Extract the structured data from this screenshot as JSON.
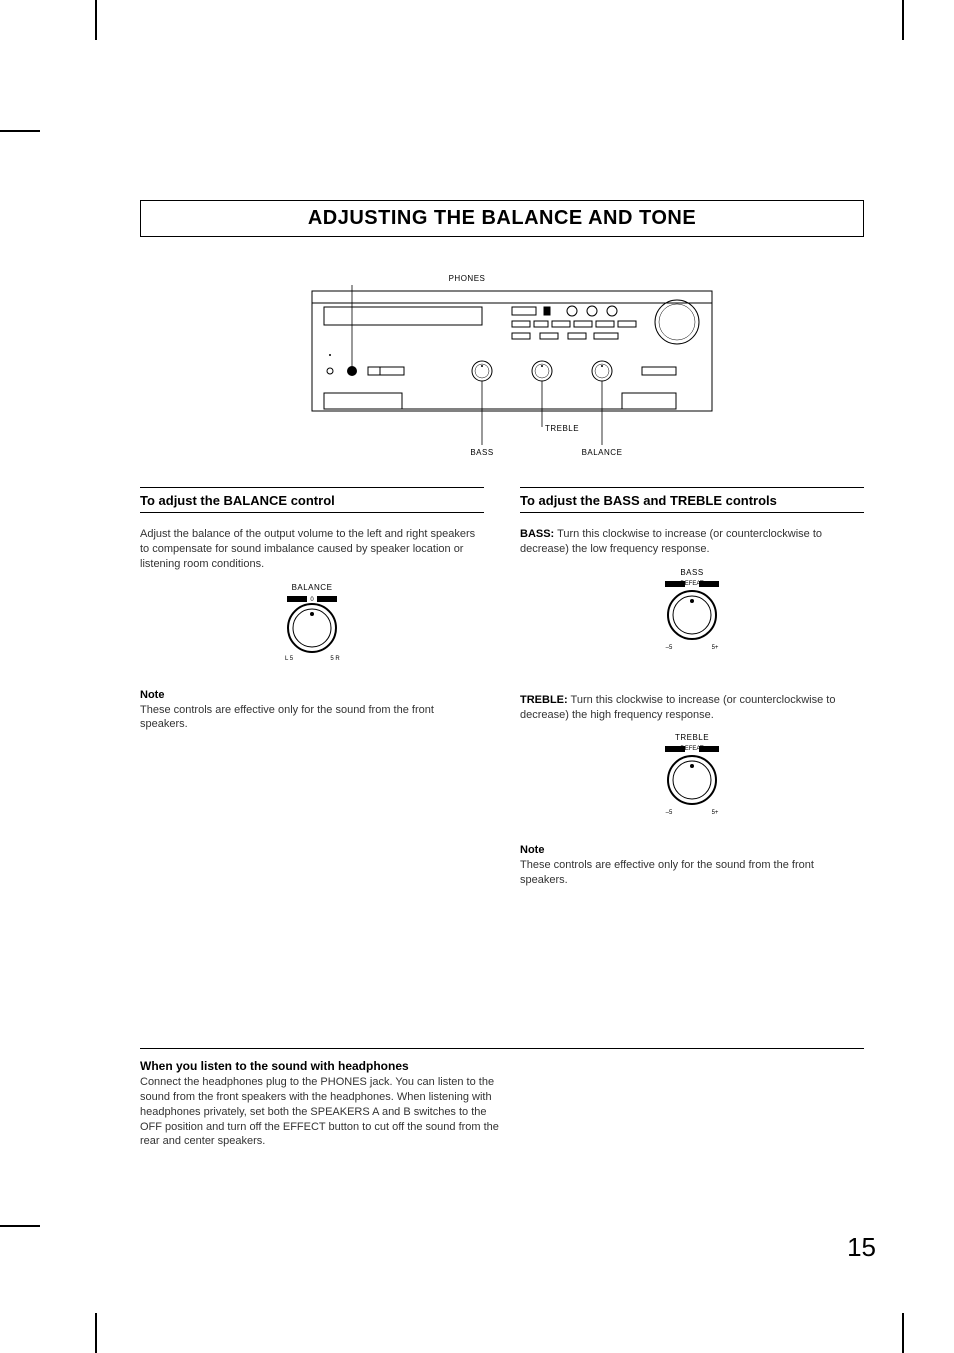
{
  "title": "ADJUSTING THE BALANCE AND TONE",
  "diagram": {
    "phones_label": "PHONES",
    "bass_label": "BASS",
    "treble_label": "TREBLE",
    "balance_label": "BALANCE"
  },
  "left": {
    "heading": "To adjust the BALANCE control",
    "body": "Adjust the balance of the output volume to the left and right speakers to compensate for sound imbalance caused by speaker location or listening room conditions.",
    "dial_label": "BALANCE",
    "dial_center": "0",
    "dial_left": "L 5",
    "dial_right": "5 R",
    "note_heading": "Note",
    "note_body": "These controls are effective only for the sound from the front speakers."
  },
  "right": {
    "heading": "To adjust the BASS and TREBLE controls",
    "bass_label": "BASS:",
    "bass_body": "Turn this clockwise to increase (or counterclockwise to decrease) the low frequency response.",
    "bass_dial_label": "BASS",
    "bass_defeat": "DEFEAT",
    "bass_left": "–5",
    "bass_right": "5+",
    "treble_label": "TREBLE:",
    "treble_body": "Turn this clockwise to increase (or counterclockwise to decrease) the high frequency response.",
    "treble_dial_label": "TREBLE",
    "treble_defeat": "DEFEAT",
    "treble_left": "–5",
    "treble_right": "5+",
    "note_heading": "Note",
    "note_body": "These controls are effective only for the sound from the front speakers."
  },
  "headphones": {
    "heading": "When you listen to the sound with headphones",
    "body": "Connect the headphones plug to the PHONES jack. You can listen to the sound from the front speakers with the headphones.  When listening with headphones privately, set both the SPEAKERS A and B switches to the OFF position and turn off the EFFECT button to cut off the sound from the rear and center speakers."
  },
  "page_number": "15"
}
